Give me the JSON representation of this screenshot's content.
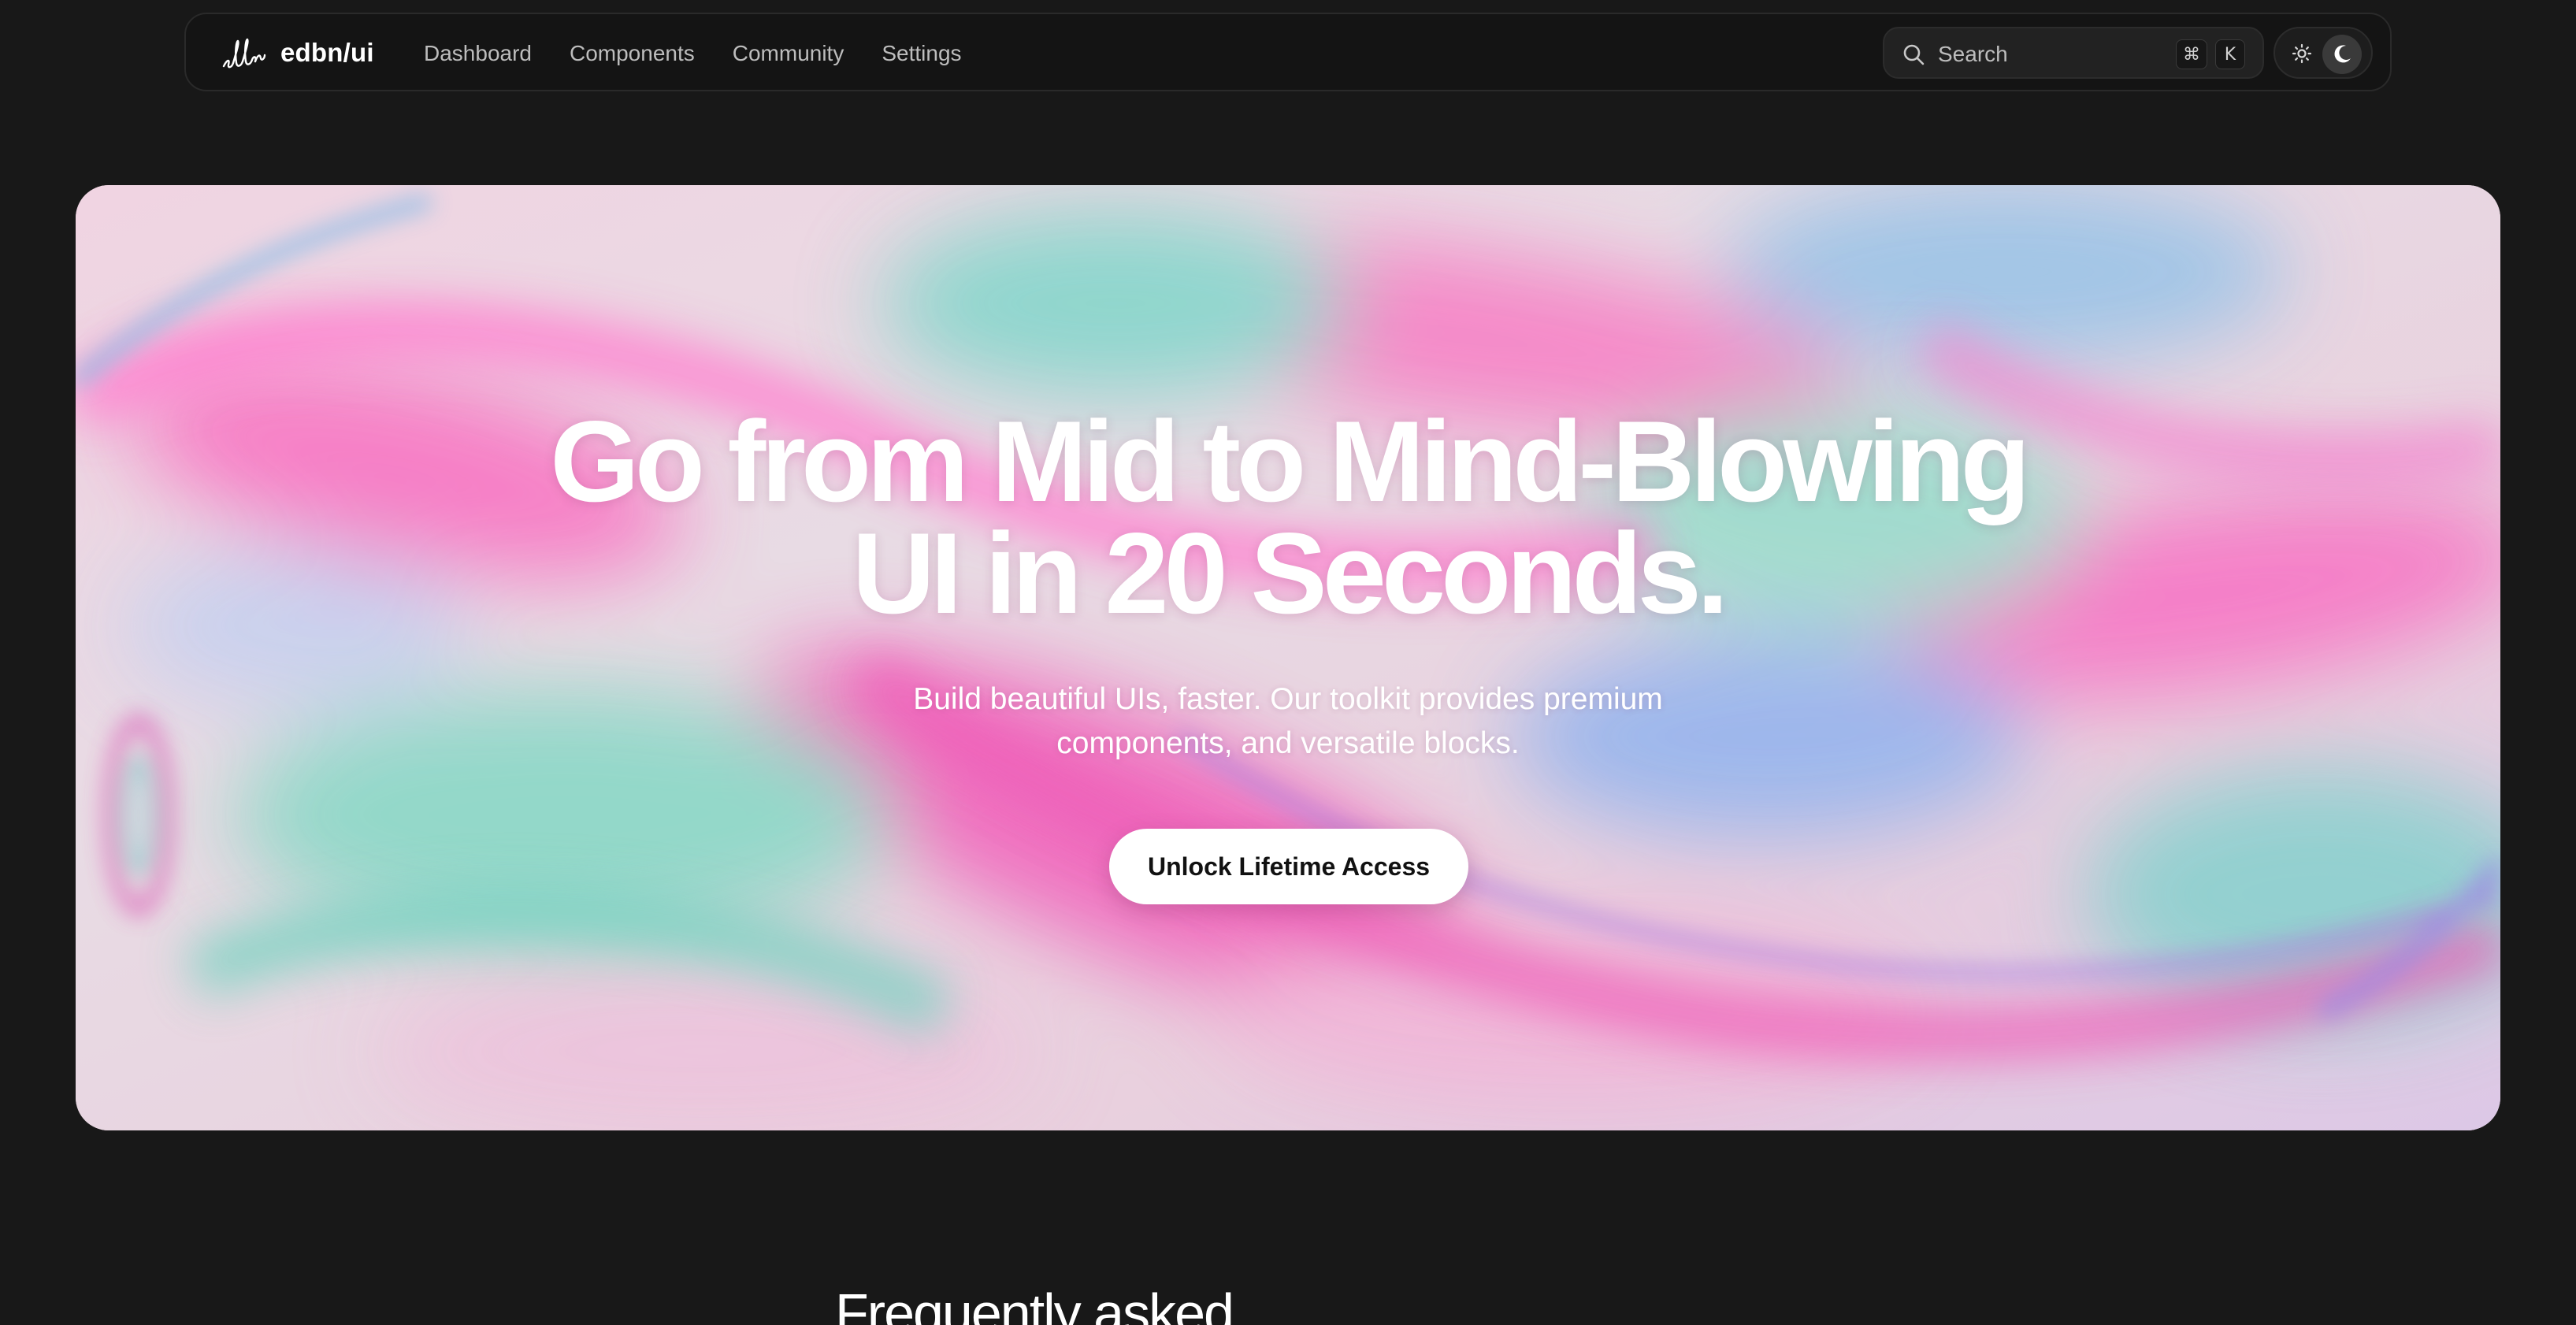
{
  "brand": {
    "logo_icon": "edbn-signature-logo",
    "name": "edbn/ui"
  },
  "nav": {
    "items": [
      {
        "label": "Dashboard"
      },
      {
        "label": "Components"
      },
      {
        "label": "Community"
      },
      {
        "label": "Settings"
      }
    ]
  },
  "search": {
    "icon": "search-icon",
    "placeholder": "Search",
    "shortcut_modifier": "⌘",
    "shortcut_key": "K"
  },
  "theme": {
    "light_icon": "sun-icon",
    "dark_icon": "moon-icon",
    "active": "dark"
  },
  "hero": {
    "title_line1": "Go from Mid to Mind-Blowing",
    "title_line2": "UI in 20 Seconds.",
    "subtitle_line1": "Build beautiful UIs, faster. Our toolkit provides premium",
    "subtitle_line2": "components, and versatile blocks.",
    "cta_label": "Unlock Lifetime Access"
  },
  "faq": {
    "heading": "Frequently asked"
  },
  "colors": {
    "page_background": "#181818",
    "navbar_background": "#141414",
    "cta_background": "#ffffff",
    "cta_text": "#111111"
  }
}
